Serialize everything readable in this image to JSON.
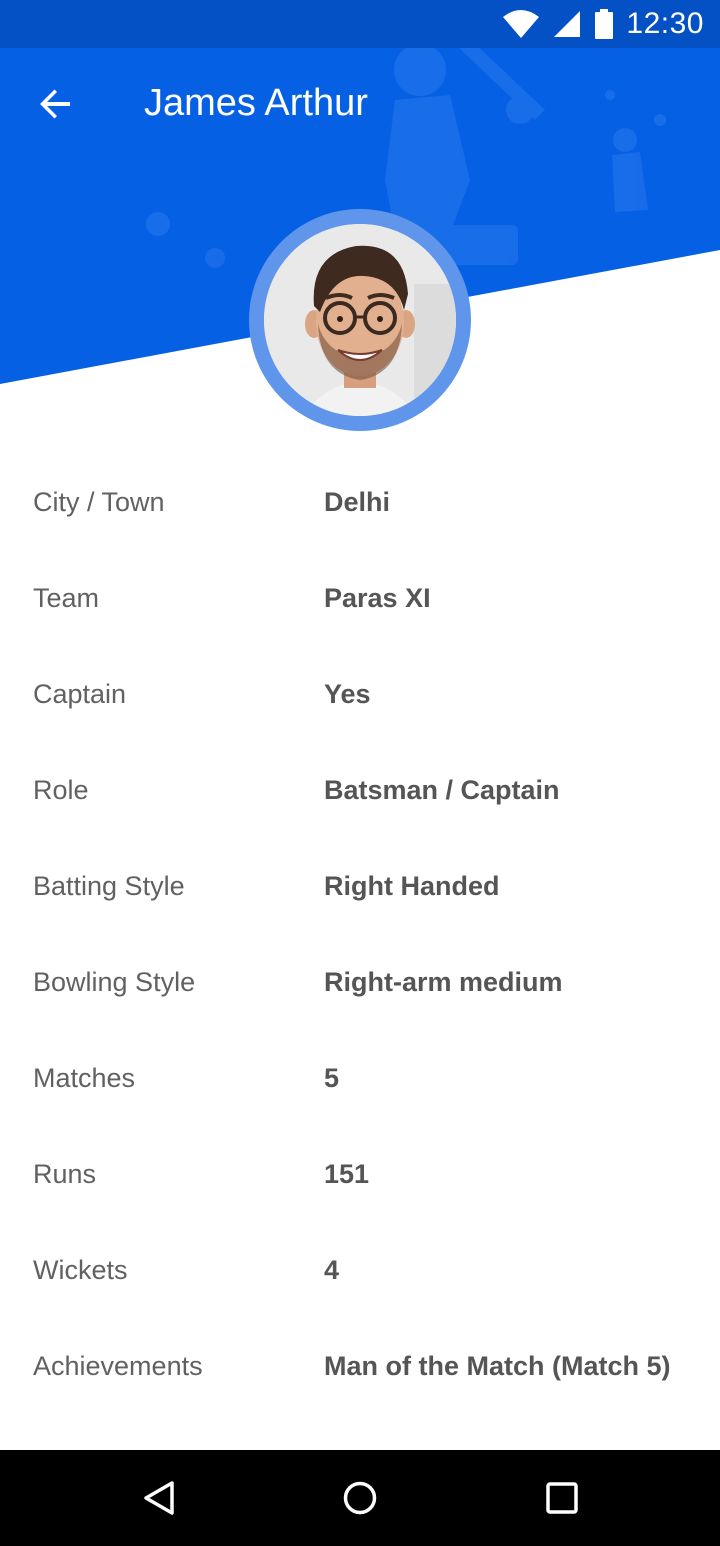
{
  "status_bar": {
    "time": "12:30",
    "icons": [
      "wifi-icon",
      "signal-icon",
      "battery-icon"
    ]
  },
  "app_bar": {
    "title": "James Arthur",
    "back_icon": "arrow-back-icon"
  },
  "profile": {
    "avatar": "player-avatar"
  },
  "details": [
    {
      "label": "City / Town",
      "value": "Delhi"
    },
    {
      "label": "Team",
      "value": "Paras XI"
    },
    {
      "label": "Captain",
      "value": "Yes"
    },
    {
      "label": "Role",
      "value": "Batsman / Captain"
    },
    {
      "label": "Batting Style",
      "value": "Right Handed"
    },
    {
      "label": "Bowling Style",
      "value": "Right-arm medium"
    },
    {
      "label": "Matches",
      "value": "5"
    },
    {
      "label": "Runs",
      "value": "151"
    },
    {
      "label": "Wickets",
      "value": "4"
    },
    {
      "label": "Achievements",
      "value": "Man of the Match (Match 5)"
    }
  ],
  "nav_bar": {
    "icons": [
      "back-triangle-icon",
      "home-circle-icon",
      "recents-square-icon"
    ]
  },
  "colors": {
    "primary": "#0660e3",
    "status_bar": "#0451c5",
    "avatar_ring": "#5f96ec",
    "label_text": "#616161",
    "value_text": "#555555"
  }
}
